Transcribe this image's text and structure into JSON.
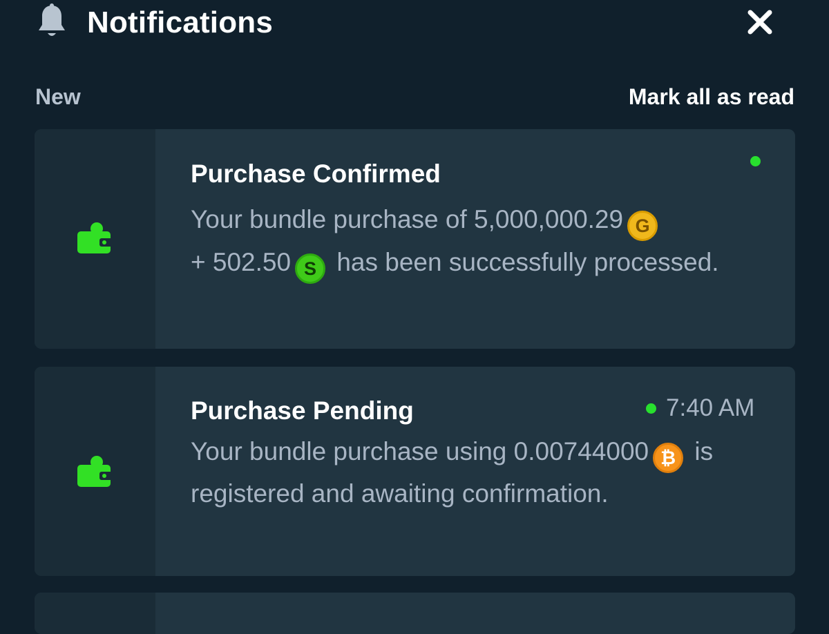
{
  "header": {
    "title": "Notifications",
    "close_icon": "close-icon",
    "bell_icon": "bell-icon"
  },
  "section": {
    "label": "New",
    "mark_all": "Mark all as read"
  },
  "colors": {
    "background": "#10202c",
    "card": "#213541",
    "rail": "#1a2c37",
    "unread_dot": "#28e02e",
    "wallet_icon": "#32e025",
    "gold_coin": "#f0b81c",
    "sweeps_coin": "#3fcb19",
    "bitcoin": "#f7931a"
  },
  "notifications": [
    {
      "title": "Purchase Confirmed",
      "icon": "wallet-icon",
      "unread": true,
      "time": "",
      "text_1": "Your bundle purchase of 5,000,000.29",
      "coin_1": "G",
      "text_2": "+ 502.50",
      "coin_2": "S",
      "text_3": "has been successfully processed."
    },
    {
      "title": "Purchase Pending",
      "icon": "wallet-icon",
      "unread": true,
      "time": "7:40 AM",
      "text_1": "Your bundle purchase using 0.00744000",
      "coin_1": "₿",
      "text_2": "is registered and awaiting confirmation."
    }
  ]
}
